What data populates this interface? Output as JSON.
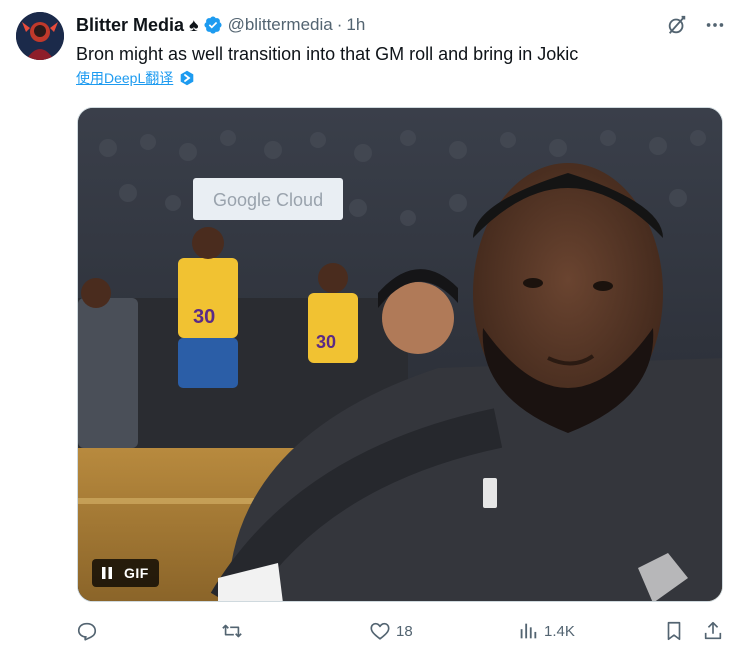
{
  "tweet": {
    "author": {
      "display_name": "Blitter Media",
      "badge_glyph": "♠",
      "handle": "@blittermedia",
      "separator": "·",
      "time": "1h",
      "verified": true
    },
    "text": "Bron might as well transition into that GM roll and bring in Jokic",
    "translate_label": "使用DeepL翻译",
    "media": {
      "type": "gif",
      "badge_label": "GIF",
      "paused": false
    },
    "actions": {
      "reply_count": "",
      "retweet_count": "",
      "like_count": "18",
      "views_count": "1.4K"
    }
  },
  "icons": {
    "top_right": [
      "grok-icon",
      "more-icon"
    ],
    "action_row": [
      "reply-icon",
      "retweet-icon",
      "like-icon",
      "views-icon",
      "bookmark-icon",
      "share-icon"
    ]
  },
  "colors": {
    "text_primary": "#0f1419",
    "text_secondary": "#536471",
    "link_blue": "#1d9bf0",
    "verified_blue": "#1d9bf0"
  }
}
